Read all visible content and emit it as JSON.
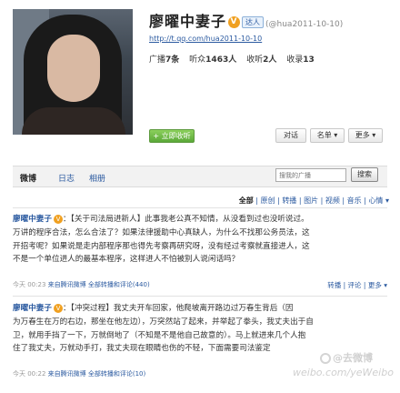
{
  "profile": {
    "name": "廖曜中妻子",
    "verified_mark": "V",
    "member_badge": "达人",
    "handle": "(@hua2011-10-10)",
    "url": "http://t.qq.com/hua2011-10-10",
    "stats": {
      "broadcast_label": "广播",
      "broadcast_value": "7条",
      "listeners_label": "听众",
      "listeners_value": "1463人",
      "listening_label": "收听",
      "listening_value": "2人",
      "collection_label": "收录",
      "collection_value": "13"
    },
    "follow_label": "+ 立即收听",
    "actions": [
      "对话",
      "名单",
      "更多"
    ]
  },
  "tabs": [
    "微博",
    "日志",
    "相册"
  ],
  "search": {
    "placeholder": "搜我的广播",
    "button": "搜索"
  },
  "filter": {
    "all": "全部",
    "items": [
      "原创",
      "转播",
      "图片",
      "视频",
      "音乐",
      "心情"
    ]
  },
  "posts": [
    {
      "author": "廖曜中妻子",
      "lines": [
        "：【关于司法局进新人】此事我老公真不知情，从没看到过也没听说过。",
        "万讲的程序合法，怎么合法了？如果法律援助中心真缺人，为什么不找那公务员法，这",
        "开招考呢？如果说是走内部程序那也得先考察再研究呀，没有经过考察就直接进人，这",
        "不是一个单位进人的最基本程序，这样进人不怕被别人说闲话吗？"
      ],
      "time": "今天 00:23",
      "source": "来自腾讯微博",
      "retweets": "全部转播和评论(440)",
      "ops": [
        "转播",
        "评论",
        "更多"
      ]
    },
    {
      "author": "廖曜中妻子",
      "lines": [
        "：【冲突过程】我丈夫开车回家，他爬坡离开路边过万春生背后（因",
        "为万春生在万的右边，那坐在他左边），万突然站了起来，并举起了拳头，我丈夫出于自",
        "卫，就用手挡了一下，万就倒地了（不知是不是他自己故意的）。马上就进来几个人抱",
        "住了我丈夫，万就动手打，我丈夫现在眼睛也伤的不轻，下面需要司法鉴定"
      ],
      "time": "今天 00:22",
      "source": "来自腾讯微博",
      "retweets": "全部转播和评论(10)",
      "ops": [
        "转播",
        "评论",
        "更多"
      ]
    }
  ],
  "watermark": {
    "line1": "@去微博",
    "line2": "weibo.com/yeWeibo"
  }
}
